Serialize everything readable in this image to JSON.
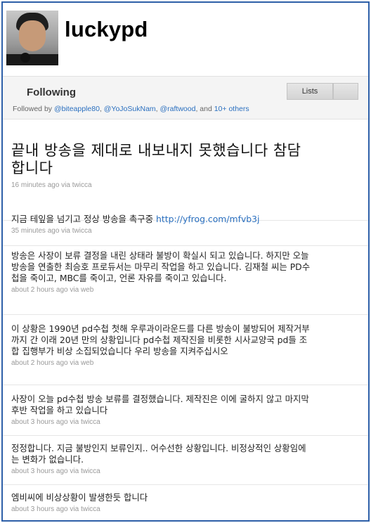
{
  "profile": {
    "screen_name": "luckypd"
  },
  "following": {
    "title": "Following",
    "followed_by_prefix": "Followed by ",
    "followers": [
      "@biteapple80",
      "@YoJoSukNam",
      "@raftwood"
    ],
    "sep1": ", ",
    "sep2": ", ",
    "sep3": ", and ",
    "others": "10+ others",
    "lists_label": "Lists"
  },
  "tweets": [
    {
      "text": "끝내 방송을 제대로 내보내지 못했습니다 참담합니다",
      "meta": "16 minutes ago via twicca"
    },
    {
      "text": "지금 테잎을 넘기고 정상 방송을 촉구중 ",
      "link": "http://yfrog.com/mfvb3j",
      "meta": "35 minutes ago via twicca"
    },
    {
      "text": "방송은 사장이 보류 결정을 내린 상태라 불방이 확실시 되고 있습니다. 하지만 오늘 방송을 연출한 최승호 프로듀서는 마무리 작업을 하고 있습니다. 김재철 씨는 PD수첩을 죽이고, MBC를 죽이고, 언론 자유를 죽이고 있습니다.",
      "meta": "about 2 hours ago via web"
    },
    {
      "text": "이 상황은 1990년 pd수첩 첫해 우루과이라운드를 다른 방송이 불방되어 제작거부까지 간 이래 20년 만의 상황입니다 pd수첩 제작진을 비롯한 시사교양국 pd들 조합 집행부가 비상 소집되었습니다 우리 방송을 지켜주십시오",
      "meta": "about 2 hours ago via web"
    },
    {
      "text": "사장이 오늘 pd수첩 방송 보류를 결정했습니다. 제작진은 이에 굴하지 않고 마지막 후반 작업을 하고 있습니다",
      "meta": "about 3 hours ago via twicca"
    },
    {
      "text": "정정합니다. 지금 불방인지 보류인지.. 어수선한 상황입니다. 비정상적인 상황임에는 변화가 없습니다.",
      "meta": "about 3 hours ago via twicca"
    },
    {
      "text": "엠비씨에 비상상황이 발생한듯 합니다",
      "meta": "about 3 hours ago via twicca"
    }
  ]
}
